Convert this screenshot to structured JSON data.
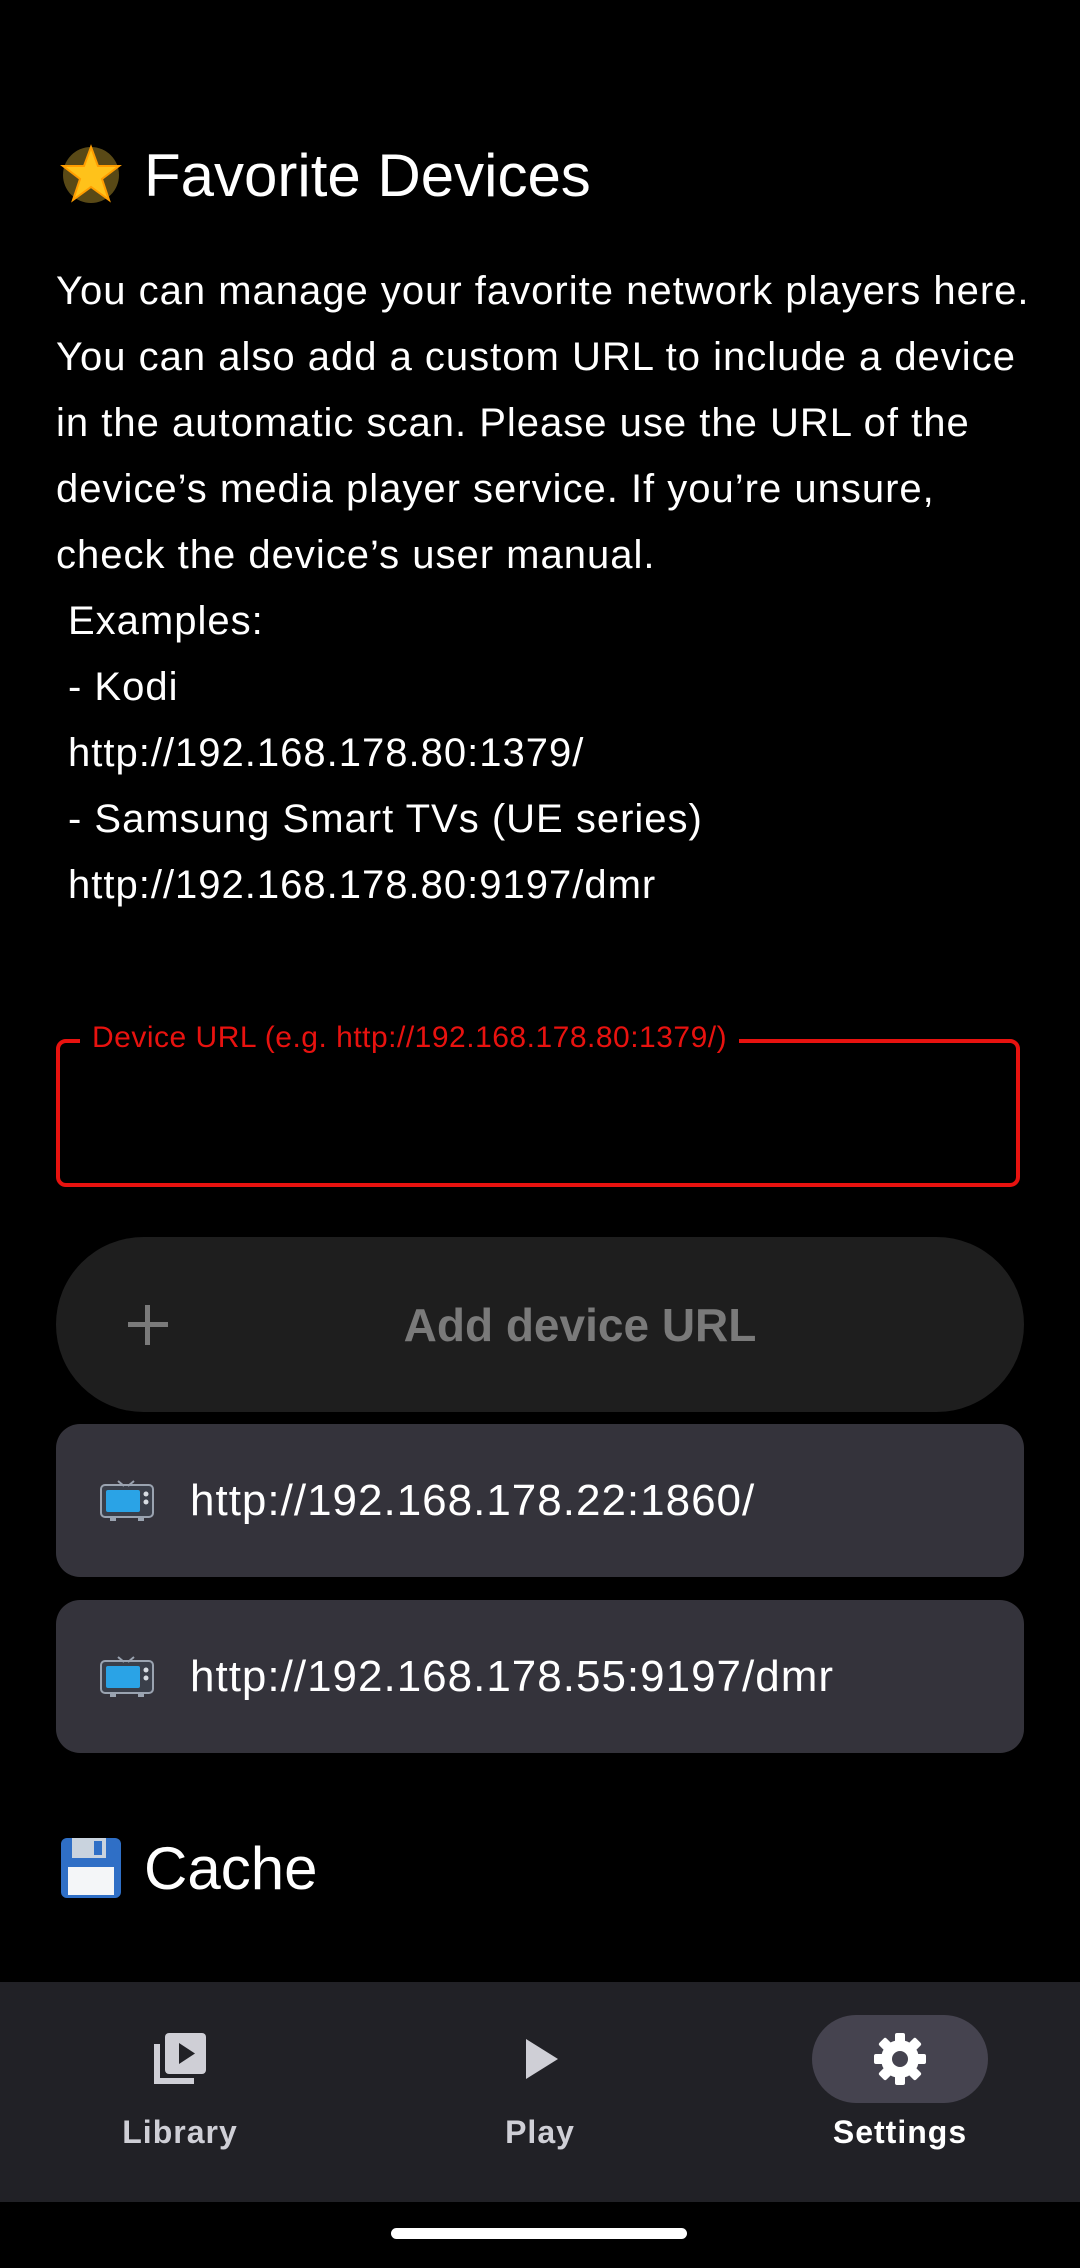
{
  "favorites": {
    "title": "Favorite Devices",
    "title_icon": "star-emoji",
    "description": "You can manage your favorite network players here. You can also add a custom URL to include a device in the automatic scan. Please use the URL of the device’s media player service. If you’re unsure, check the device’s user manual.",
    "examples_heading": "Examples:",
    "examples": [
      "- Kodi",
      "http://192.168.178.80:1379/",
      "- Samsung Smart TVs (UE series)",
      "http://192.168.178.80:9197/dmr"
    ]
  },
  "url_field": {
    "label": "Device URL (e.g. http://192.168.178.80:1379/)",
    "value": "",
    "error_color": "#e8120f"
  },
  "add_button": {
    "label": "Add device URL",
    "icon": "plus-icon"
  },
  "devices": [
    {
      "icon": "tv-emoji",
      "url": "http://192.168.178.22:1860/"
    },
    {
      "icon": "tv-emoji",
      "url": "http://192.168.178.55:9197/dmr"
    }
  ],
  "cache": {
    "title": "Cache",
    "title_icon": "floppy-disk-emoji"
  },
  "nav": {
    "items": [
      {
        "label": "Library",
        "icon": "library-icon",
        "active": false
      },
      {
        "label": "Play",
        "icon": "play-icon",
        "active": false
      },
      {
        "label": "Settings",
        "icon": "gear-icon",
        "active": true
      }
    ]
  },
  "colors": {
    "background": "#000000",
    "card": "#34333b",
    "button": "#1e1e1e",
    "nav_bar": "#212126",
    "active_pill": "#45434f"
  }
}
